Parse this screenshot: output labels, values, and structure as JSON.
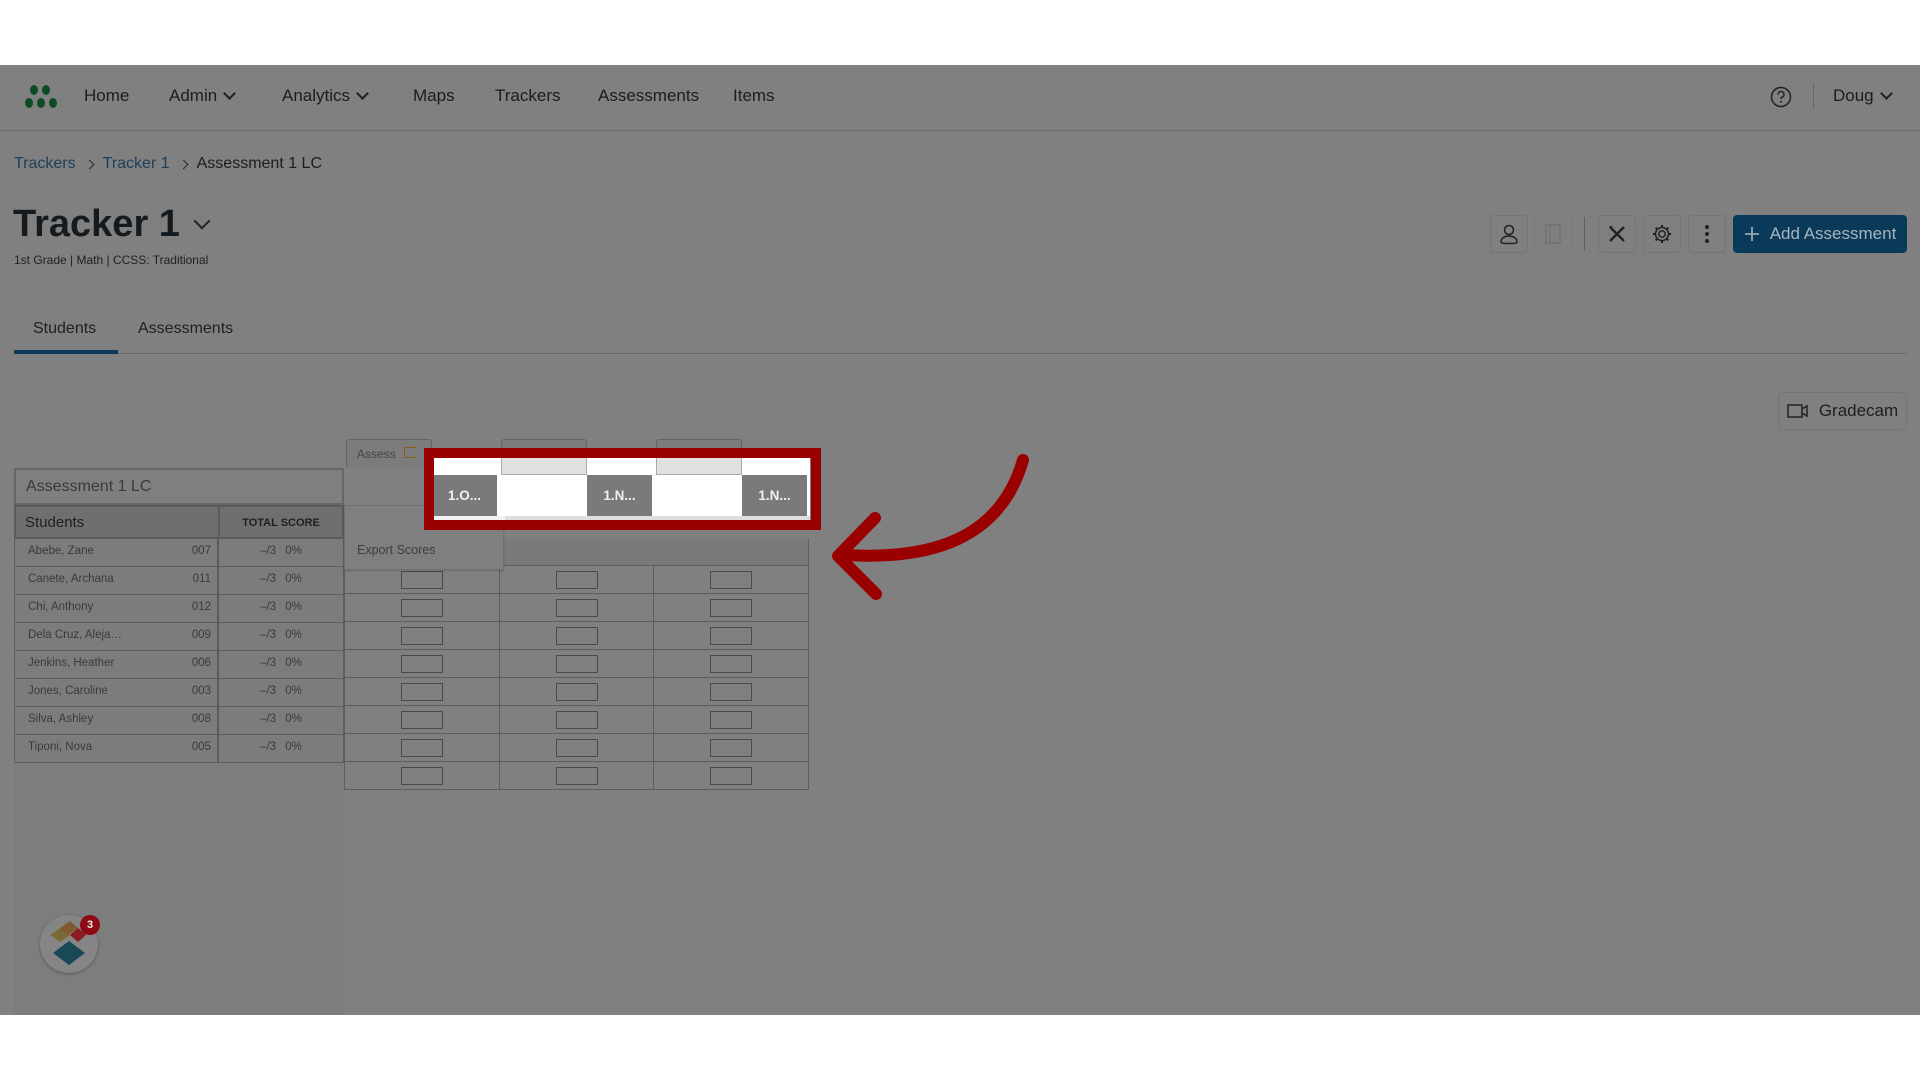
{
  "nav": {
    "items": [
      {
        "label": "Home",
        "has_dropdown": false
      },
      {
        "label": "Admin",
        "has_dropdown": true
      },
      {
        "label": "Analytics",
        "has_dropdown": true
      },
      {
        "label": "Maps",
        "has_dropdown": false
      },
      {
        "label": "Trackers",
        "has_dropdown": false
      },
      {
        "label": "Assessments",
        "has_dropdown": false
      },
      {
        "label": "Items",
        "has_dropdown": false
      }
    ],
    "user": "Doug",
    "help_icon": "question-circle-icon"
  },
  "breadcrumb": [
    "Trackers",
    "Tracker 1",
    "Assessment 1 LC"
  ],
  "header": {
    "title": "Tracker 1",
    "subtitle": "1st Grade  |  Math  |  CCSS: Traditional"
  },
  "toolbar": {
    "icons": [
      "student-icon",
      "notebook-icon",
      "tools-icon",
      "gear-icon",
      "kebab-menu-icon"
    ],
    "add_label": "Add Assessment"
  },
  "tabs": [
    {
      "label": "Students",
      "active": true
    },
    {
      "label": "Assessments",
      "active": false
    }
  ],
  "gradecam_label": "Gradecam",
  "table": {
    "assessment_name": "Assessment 1 LC",
    "col_students": "Students",
    "col_total": "TOTAL SCORE",
    "assess_tab_label": "Assess",
    "export_label": "Export Scores",
    "standards": [
      "1.O...",
      "1.N...",
      "1.N..."
    ],
    "rows": [
      {
        "name": "Abebe, Zane",
        "id": "007",
        "score": "–/3",
        "pct": "0%"
      },
      {
        "name": "Canete, Archana",
        "id": "011",
        "score": "–/3",
        "pct": "0%"
      },
      {
        "name": "Chi, Anthony",
        "id": "012",
        "score": "–/3",
        "pct": "0%"
      },
      {
        "name": "Dela Cruz, Aleja…",
        "id": "009",
        "score": "–/3",
        "pct": "0%"
      },
      {
        "name": "Jenkins, Heather",
        "id": "006",
        "score": "–/3",
        "pct": "0%"
      },
      {
        "name": "Jones, Caroline",
        "id": "003",
        "score": "–/3",
        "pct": "0%"
      },
      {
        "name": "Silva, Ashley",
        "id": "008",
        "score": "–/3",
        "pct": "0%"
      },
      {
        "name": "Tiponi, Nova",
        "id": "005",
        "score": "–/3",
        "pct": "0%"
      }
    ]
  },
  "help_widget": {
    "badge_count": "3"
  },
  "annotation": {
    "color": "#9b0000",
    "target": "standard-headers"
  },
  "colors": {
    "primary": "#0a3a59",
    "logo": "#0d4a26",
    "overlay": "#808080"
  }
}
